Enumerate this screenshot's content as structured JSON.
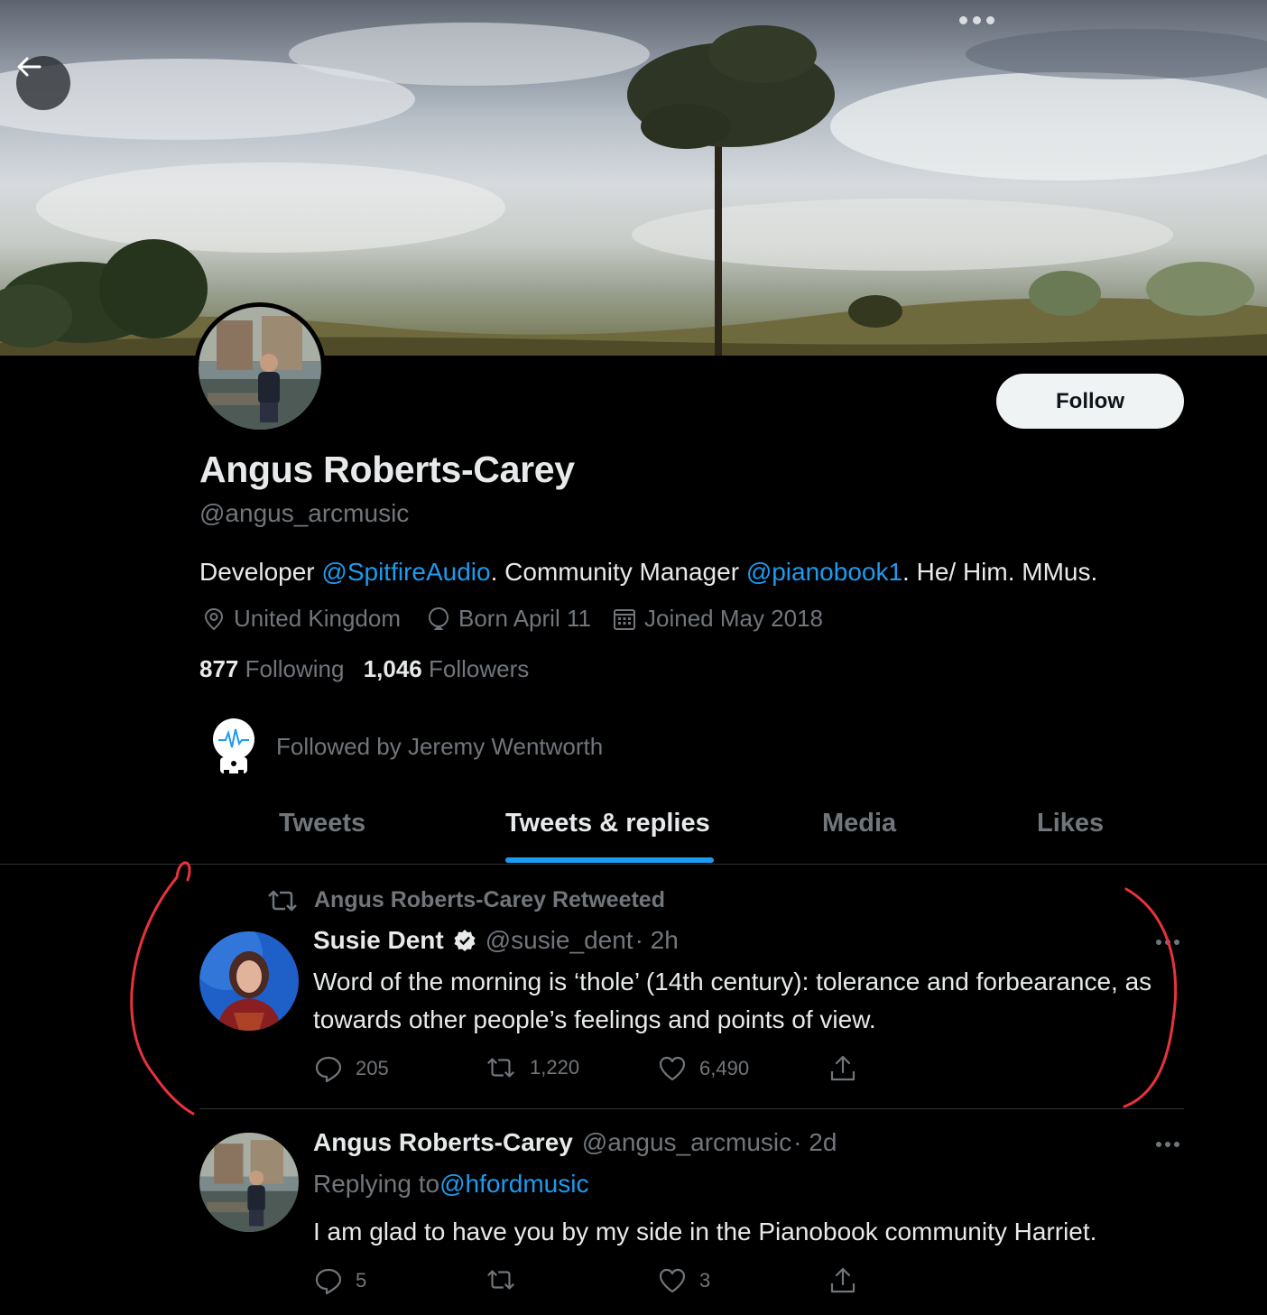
{
  "profile": {
    "display_name": "Angus Roberts-Carey",
    "handle": "@angus_arcmusic",
    "bio_prefix": "Developer ",
    "bio_link1": "@SpitfireAudio",
    "bio_middle": ". Community Manager ",
    "bio_link2": "@pianobook1",
    "bio_suffix": ". He/ Him. MMus.",
    "location": "United Kingdom",
    "birthday": "Born April 11",
    "joined": "Joined May 2018",
    "following_count": "877",
    "following_label": "Following",
    "followers_count": "1,046",
    "followers_label": "Followers",
    "followed_by": "Followed by Jeremy Wentworth",
    "follow_button": "Follow"
  },
  "tabs": [
    {
      "label": "Tweets",
      "active": false
    },
    {
      "label": "Tweets & replies",
      "active": true
    },
    {
      "label": "Media",
      "active": false
    },
    {
      "label": "Likes",
      "active": false
    }
  ],
  "tweets": [
    {
      "retweeted_by": "Angus Roberts-Carey Retweeted",
      "author": "Susie Dent",
      "verified": true,
      "handle": "@susie_dent",
      "time": "· 2h",
      "text": "Word of the morning is ‘thole’ (14th century): tolerance and forbearance, as towards other people’s feelings and points of view.",
      "replies": "205",
      "retweets": "1,220",
      "likes": "6,490"
    },
    {
      "author": "Angus Roberts-Carey",
      "handle": "@angus_arcmusic",
      "time": "· 2d",
      "replying_prefix": "Replying to ",
      "replying_to": "@hfordmusic",
      "text": "I am glad to have you by my side in the Pianobook community Harriet.",
      "replies": "5",
      "retweets": "",
      "likes": "3"
    }
  ],
  "icons": {
    "back": "arrow-left-icon",
    "location": "location-pin-icon",
    "birthday": "balloon-icon",
    "joined": "calendar-icon",
    "retweet": "retweet-icon",
    "reply": "reply-icon",
    "like": "heart-icon",
    "share": "share-icon",
    "verified": "verified-badge-icon",
    "more": "more-icon"
  },
  "colors": {
    "background": "#000000",
    "accent": "#1d9bf0",
    "text_primary": "#e7e9ea",
    "text_secondary": "#71767b",
    "annotation": "#e8333c"
  }
}
